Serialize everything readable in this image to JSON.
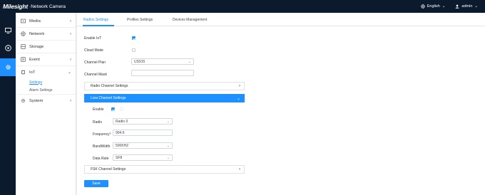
{
  "header": {
    "brand": "Milesight",
    "product": "Network Camera",
    "language": "English",
    "user": "admin"
  },
  "sidebar": {
    "items": [
      {
        "label": "Media",
        "icon": "media-icon"
      },
      {
        "label": "Network",
        "icon": "network-icon"
      },
      {
        "label": "Storage",
        "icon": "storage-icon"
      },
      {
        "label": "Event",
        "icon": "event-icon"
      },
      {
        "label": "IoT",
        "icon": "iot-icon"
      },
      {
        "label": "System",
        "icon": "system-icon"
      }
    ],
    "iot_subitems": [
      "Settings",
      "Alarm Settings"
    ]
  },
  "tabs": [
    "Radios Settings",
    "Profiles Settings",
    "Devices Management"
  ],
  "form": {
    "enable_iot_label": "Enable IoT",
    "cloud_mode_label": "Cloud Mode",
    "channel_plan_label": "Channel Plan",
    "channel_plan_value": "US915",
    "channel_mask_label": "Channel Mask",
    "channel_mask_value": ""
  },
  "sections": {
    "radio": "Radio Channel Settings",
    "lora": "Lora Channel Settings",
    "fsk": "FSK Channel Settings"
  },
  "lora": {
    "enable_label": "Enable",
    "radio_label": "Radio",
    "radio_value": "Radio 0",
    "frequency_label": "Frequency",
    "frequency_value": "904.6",
    "bandwidth_label": "BandWidth",
    "bandwidth_value": "500KHZ",
    "datarate_label": "Data Rate",
    "datarate_value": "SF8"
  },
  "save_label": "Save"
}
